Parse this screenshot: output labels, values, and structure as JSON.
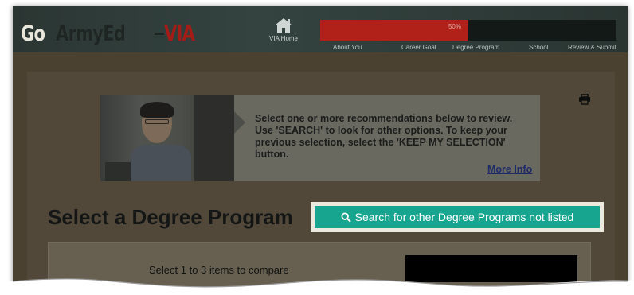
{
  "header": {
    "logo": {
      "part1": "Go",
      "part2": "ArmyEd",
      "part3": "VIA"
    },
    "home": {
      "label": "VIA Home",
      "icon": "home-icon"
    },
    "progress": {
      "percent_text": "50%",
      "value": 0.5,
      "fill_color": "#b1211a"
    },
    "steps": [
      {
        "label": "About You"
      },
      {
        "label": "Career Goal"
      },
      {
        "label": "Degree Program"
      },
      {
        "label": "School"
      },
      {
        "label": "Review & Submit"
      }
    ]
  },
  "banner": {
    "text": "Select one or more recommendations below to review. Use 'SEARCH' to look for other options. To keep your previous selection, select the 'KEEP MY SELECTION' button.",
    "more_info": "More Info",
    "print_icon": "printer-icon"
  },
  "main": {
    "title": "Select a Degree Program",
    "search_button": {
      "label": "Search for other Degree Programs not listed",
      "icon": "search-icon",
      "color": "#17a58f"
    },
    "compare": {
      "label": "Select 1 to 3 items to compare"
    }
  }
}
